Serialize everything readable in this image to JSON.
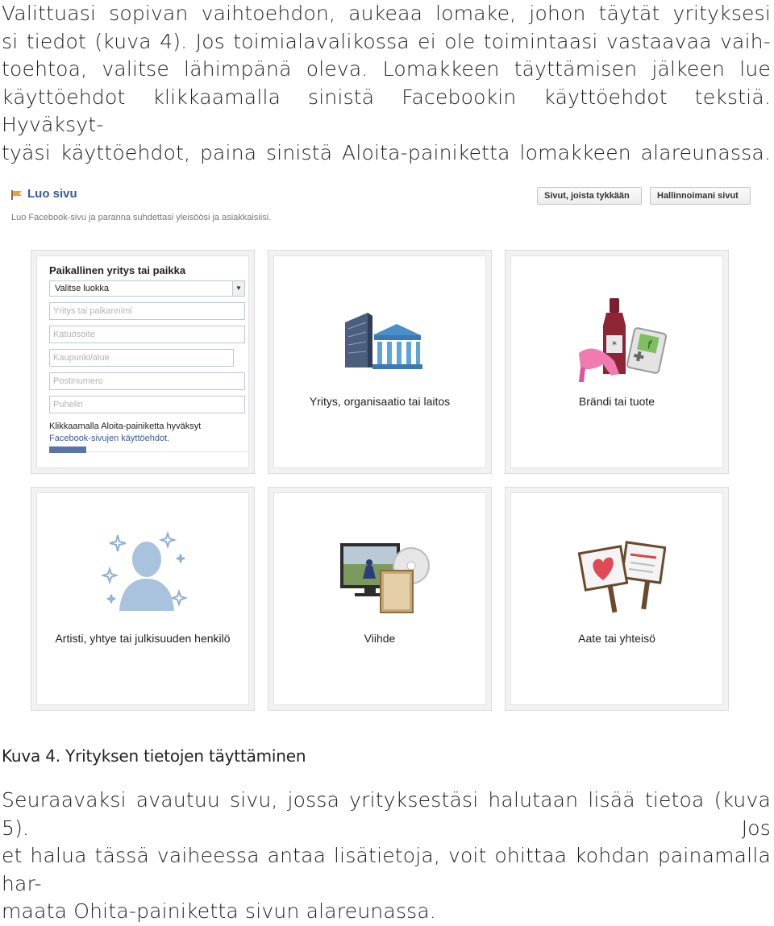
{
  "intro_lines": [
    "Valittuasi sopivan vaihtoehdon, aukeaa lomake, johon täytät yrityksesi",
    "si tiedot (kuva 4). Jos toimialavalikossa ei ole toimintaasi vastaavaa vaih-",
    "toehtoa, valitse lähimpänä oleva. Lomakkeen täyttämisen jälkeen lue",
    "käyttöehdot klikkaamalla sinistä Facebookin käyttöehdot tekstiä. Hyväksyt-",
    "tyäsi käyttöehdot, paina sinistä Aloita-painiketta lomakkeen alareunassa."
  ],
  "screenshot": {
    "page_title": "Luo sivu",
    "page_subtitle": "Luo Facebook-sivu ja paranna suhdettasi yleisöösi ja asiakkaisiisi.",
    "buttons": {
      "liked_pages": "Sivut, joista tykkään",
      "manage_pages": "Hallinnoimani sivut"
    },
    "form": {
      "title": "Paikallinen yritys tai paikka",
      "category_select": "Valitse luokka",
      "placeholders": [
        "Yritys tai paikannimi",
        "Katuosoite",
        "Kaupunki/alue",
        "Postinumero",
        "Puhelin"
      ],
      "terms_text": "Klikkaamalla Aloita-painiketta hyväksyt",
      "terms_link": "Facebook-sivujen käyttöehdot."
    },
    "categories": [
      {
        "label": "Yritys, organisaatio tai laitos",
        "icon": "building-icon"
      },
      {
        "label": "Brändi tai tuote",
        "icon": "products-icon"
      },
      {
        "label": "Artisti, yhtye tai julkisuuden henkilö",
        "icon": "person-icon"
      },
      {
        "label": "Viihde",
        "icon": "entertainment-icon"
      },
      {
        "label": "Aate tai yhteisö",
        "icon": "signs-icon"
      }
    ]
  },
  "caption": "Kuva 4. Yrityksen tietojen täyttäminen",
  "outro_lines": [
    "Seuraavaksi avautuu sivu, jossa yrityksestäsi halutaan lisää tietoa (kuva 5). Jos",
    "et halua tässä vaiheessa antaa lisätietoja, voit ohittaa kohdan painamalla har-",
    "maata Ohita-painiketta sivun alareunassa."
  ],
  "colors": {
    "facebook_blue": "#3b5998",
    "tile_bg": "#f2f2f2"
  }
}
